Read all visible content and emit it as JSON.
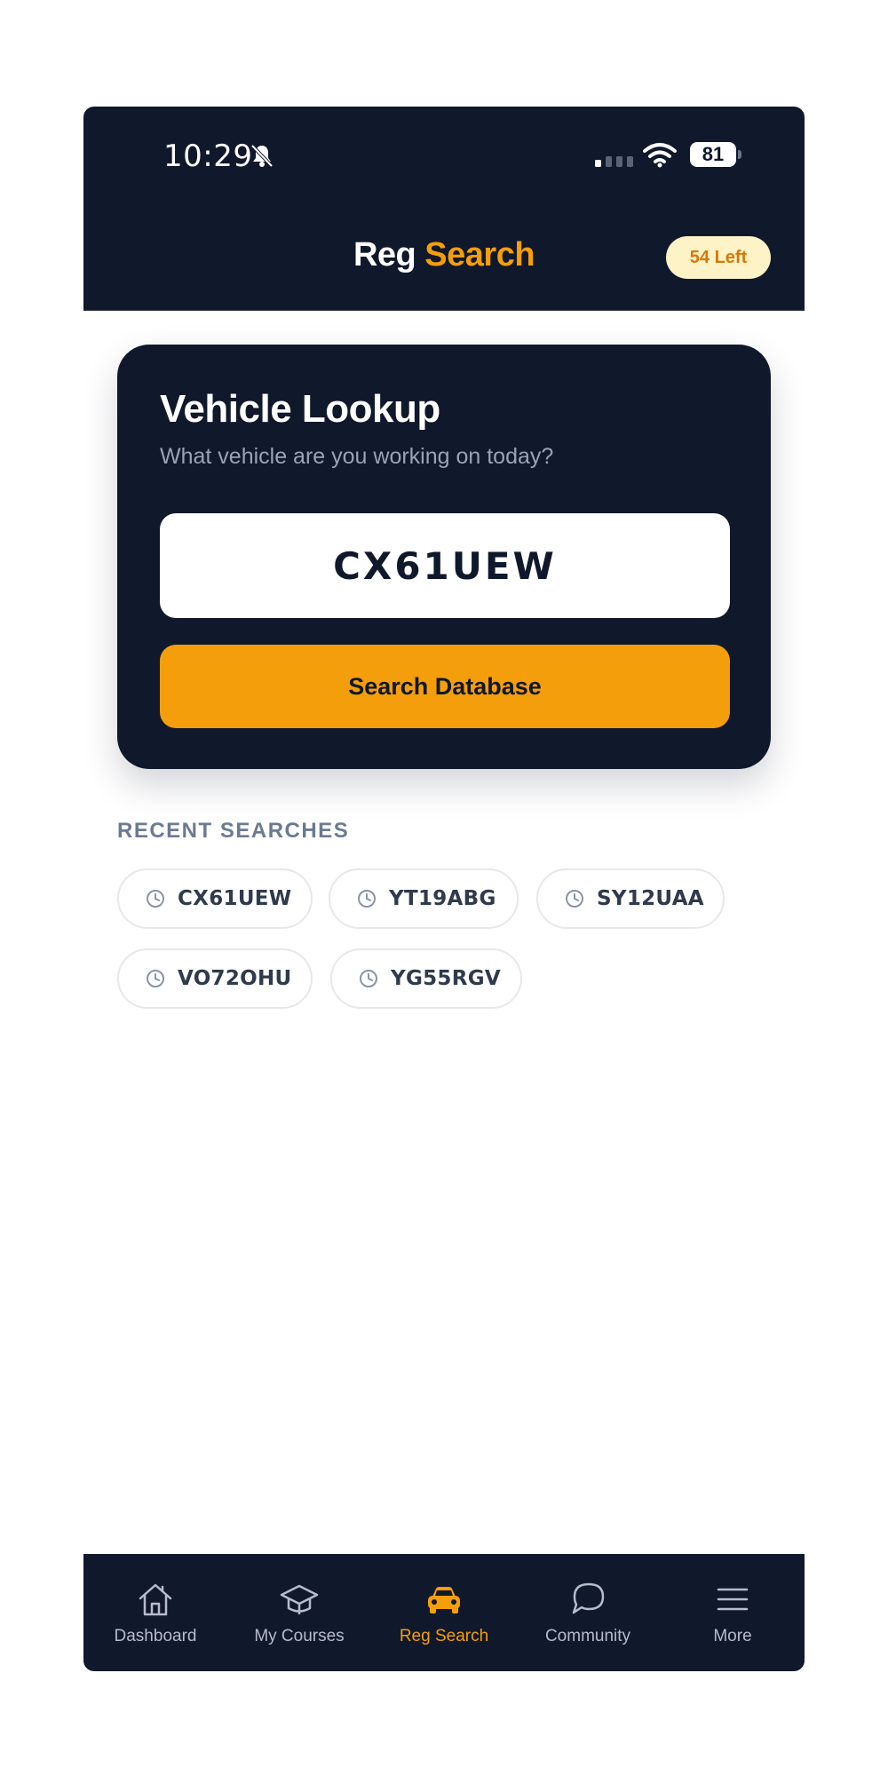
{
  "status_bar": {
    "time": "10:29",
    "battery": "81"
  },
  "header": {
    "title_part1": "Reg",
    "title_part2": "Search",
    "credits_badge": "54 Left"
  },
  "lookup": {
    "title": "Vehicle Lookup",
    "subtitle": "What vehicle are you working on today?",
    "input_value": "CX61UEW",
    "search_button": "Search Database"
  },
  "recent": {
    "heading": "RECENT SEARCHES",
    "items": [
      "CX61UEW",
      "YT19ABG",
      "SY12UAA",
      "VO72OHU",
      "YG55RGV"
    ]
  },
  "nav": {
    "active": "reg-search",
    "items": [
      {
        "label": "Dashboard",
        "icon": "home-icon"
      },
      {
        "label": "My Courses",
        "icon": "graduation-cap-icon"
      },
      {
        "label": "Reg Search",
        "icon": "car-icon"
      },
      {
        "label": "Community",
        "icon": "chat-bubble-icon"
      },
      {
        "label": "More",
        "icon": "menu-icon"
      }
    ]
  },
  "colors": {
    "navy": "#10182b",
    "accent": "#f59e0b",
    "badge_bg": "#fef3c7",
    "badge_text": "#d97706",
    "muted": "#6b7a93"
  }
}
